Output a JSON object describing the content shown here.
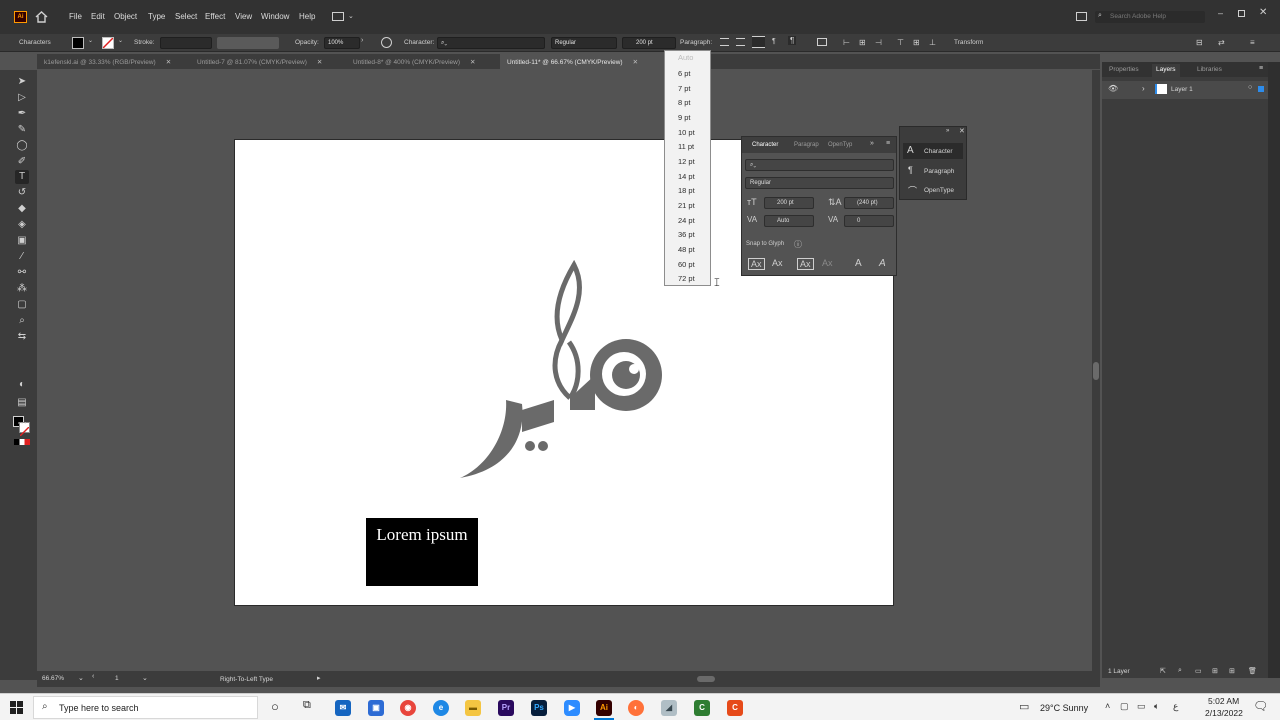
{
  "menu": {
    "items": [
      "File",
      "Edit",
      "Object",
      "Type",
      "Select",
      "Effect",
      "View",
      "Window",
      "Help"
    ],
    "search_placeholder": "Search Adobe Help"
  },
  "control": {
    "mode_label": "Characters",
    "stroke_label": "Stroke:",
    "opacity_label": "Opacity:",
    "opacity_value": "100%",
    "character_label": "Character:",
    "style_value": "Regular",
    "size_value": "200 pt",
    "paragraph_label": "Paragraph:",
    "transform_label": "Transform"
  },
  "tabs": [
    {
      "label": "k1efenskl.ai @ 33.33% (RGB/Preview)"
    },
    {
      "label": "Untitled-7 @ 81.07% (CMYK/Preview)"
    },
    {
      "label": "Untitled-8* @ 400% (CMYK/Preview)"
    },
    {
      "label": "Untitled-11* @ 66.67% (CMYK/Preview)"
    }
  ],
  "dropdown": {
    "top_hint": "Auto",
    "sizes": [
      "6 pt",
      "7 pt",
      "8 pt",
      "9 pt",
      "10 pt",
      "11 pt",
      "12 pt",
      "14 pt",
      "18 pt",
      "21 pt",
      "24 pt",
      "36 pt",
      "48 pt",
      "60 pt",
      "72 pt"
    ]
  },
  "character_panel": {
    "tabs": [
      "Character",
      "Paragrap",
      "OpenTyp"
    ],
    "style": "Regular",
    "size": "200 pt",
    "leading": "(240 pt)",
    "kerning": "Auto",
    "tracking": "0",
    "snap_label": "Snap to Glyph"
  },
  "mini_panel": {
    "items": [
      "Character",
      "Paragraph",
      "OpenType"
    ]
  },
  "right_panel": {
    "tabs": [
      "Properties",
      "Layers",
      "Libraries"
    ],
    "layer_name": "Layer 1",
    "layer_count": "1 Layer"
  },
  "artboard": {
    "text": "Lorem ipsum"
  },
  "status": {
    "zoom": "66.67%",
    "artboard_num": "1",
    "tool_info": "Right-To-Left Type"
  },
  "taskbar": {
    "search_placeholder": "Type here to search",
    "weather": "29°C  Sunny",
    "time": "5:02 AM",
    "date": "2/13/2022"
  },
  "colors": {
    "accent": "#2d8ceb",
    "illustrator": "#330000",
    "artwork": "#6a6a6a"
  }
}
